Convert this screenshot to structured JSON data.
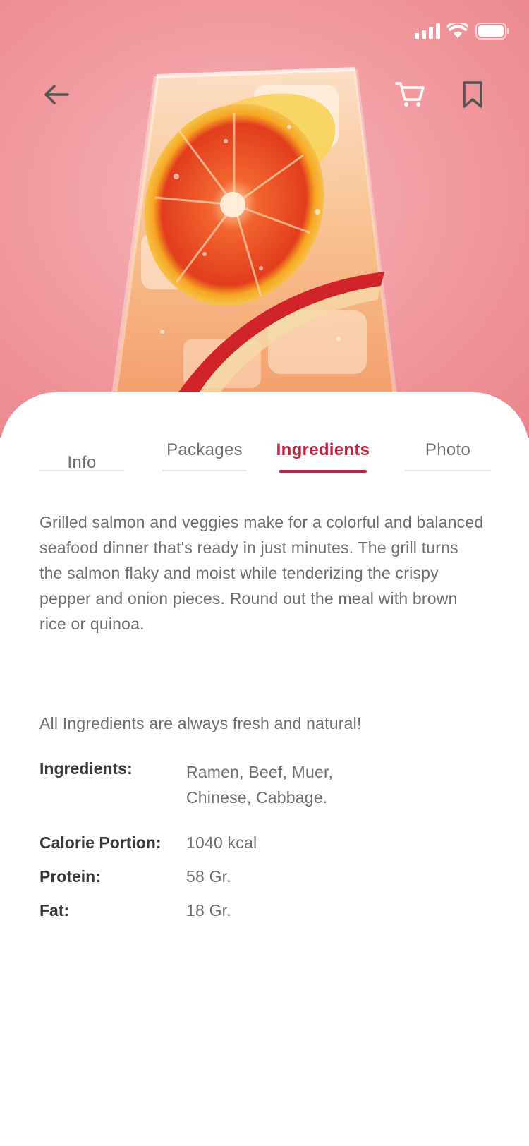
{
  "header": {
    "back_icon": "arrow-left-icon",
    "cart_icon": "cart-icon",
    "bookmark_icon": "bookmark-icon"
  },
  "status_bar": {
    "icons": [
      "signal-icon",
      "wifi-icon",
      "battery-icon"
    ]
  },
  "hero": {
    "image": "drink-with-citrus-and-apple-photo"
  },
  "tabs": [
    {
      "label": "Info",
      "active": false
    },
    {
      "label": "Packages",
      "active": false
    },
    {
      "label": "Ingredients",
      "active": true
    },
    {
      "label": "Photo",
      "active": false
    }
  ],
  "content": {
    "description": "Grilled salmon and veggies make for a colorful and balanced seafood dinner that's ready in just minutes. The grill turns the salmon flaky and moist while tenderizing the crispy pepper and onion pieces. Round out the meal with brown rice or quinoa.",
    "fresh_note": "All Ingredients are always fresh and natural!",
    "facts": {
      "ingredients_label": "Ingredients:",
      "ingredients_value": "Ramen, Beef, Muer, Chinese, Cabbage.",
      "calorie_label": "Calorie Portion:",
      "calorie_value": "1040 kcal",
      "protein_label": "Protein:",
      "protein_value": "58 Gr.",
      "fat_label": "Fat:",
      "fat_value": "18 Gr."
    }
  },
  "colors": {
    "accent": "#c0223d",
    "hero_bg": "#f29ea3",
    "text": "#6e6e6e",
    "label": "#3a3a3a"
  }
}
